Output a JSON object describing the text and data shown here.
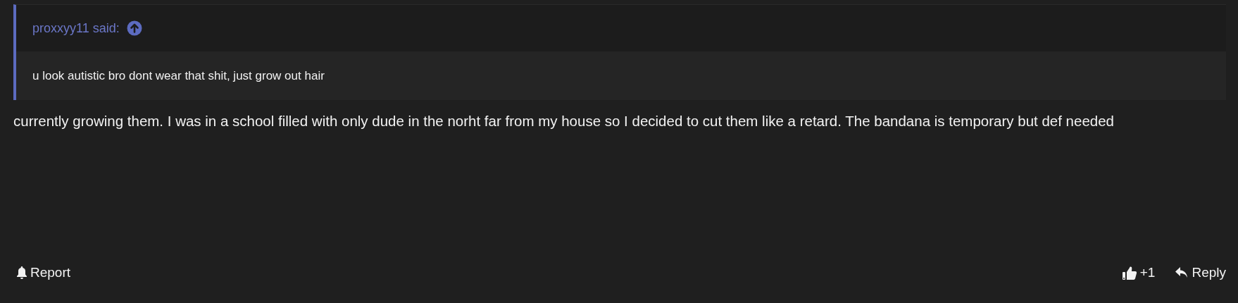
{
  "quote": {
    "author": "proxxyy11 said:",
    "text": "u look autistic bro dont wear that shit, just grow out hair"
  },
  "message": "currently growing them. I was in a school filled with only dude in the norht far from my house so I decided to cut them like a retard. The bandana is temporary but def needed",
  "actions": [
    {
      "kind": "report",
      "label": "Report"
    },
    {
      "kind": "like",
      "label": "+1"
    },
    {
      "kind": "reply",
      "label": "Reply"
    }
  ]
}
